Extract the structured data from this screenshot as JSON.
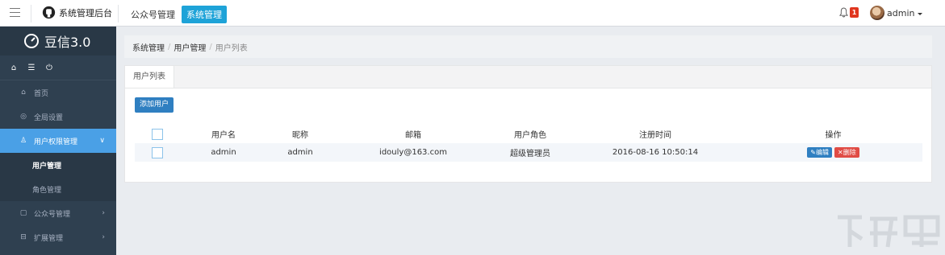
{
  "topbar": {
    "brand": "系统管理后台",
    "nav": [
      {
        "label": "公众号管理",
        "active": false
      },
      {
        "label": "系统管理",
        "active": true
      }
    ],
    "notification_count": "1",
    "username": "admin"
  },
  "sidebar": {
    "logo": "豆信3.0",
    "quick_icons": [
      "home-icon",
      "list-icon",
      "power-icon"
    ],
    "menu": [
      {
        "label": "首页",
        "icon": "home-icon"
      },
      {
        "label": "全局设置",
        "icon": "settings-icon"
      },
      {
        "label": "用户权限管理",
        "icon": "user-icon",
        "active": true
      },
      {
        "label": "用户管理",
        "sub": true,
        "current": true
      },
      {
        "label": "角色管理",
        "sub": true
      },
      {
        "label": "公众号管理",
        "icon": "wechat-icon"
      },
      {
        "label": "扩展管理",
        "icon": "extension-icon"
      }
    ]
  },
  "breadcrumb": [
    "系统管理",
    "用户管理",
    "用户列表"
  ],
  "panel": {
    "tab": "用户列表",
    "add_button": "添加用户",
    "table": {
      "headers": [
        "用户名",
        "昵称",
        "邮箱",
        "用户角色",
        "注册时间",
        "操作"
      ],
      "rows": [
        {
          "username": "admin",
          "nickname": "admin",
          "email": "idouly@163.com",
          "role": "超级管理员",
          "registered": "2016-08-16 10:50:14",
          "edit": "编辑",
          "delete": "删除"
        }
      ]
    }
  },
  "colors": {
    "sidebar_bg": "#2f4050",
    "active_menu": "#4aa0e6",
    "primary": "#2f7fc1",
    "danger": "#e04c45",
    "topnav_active": "#1ea3d8"
  }
}
